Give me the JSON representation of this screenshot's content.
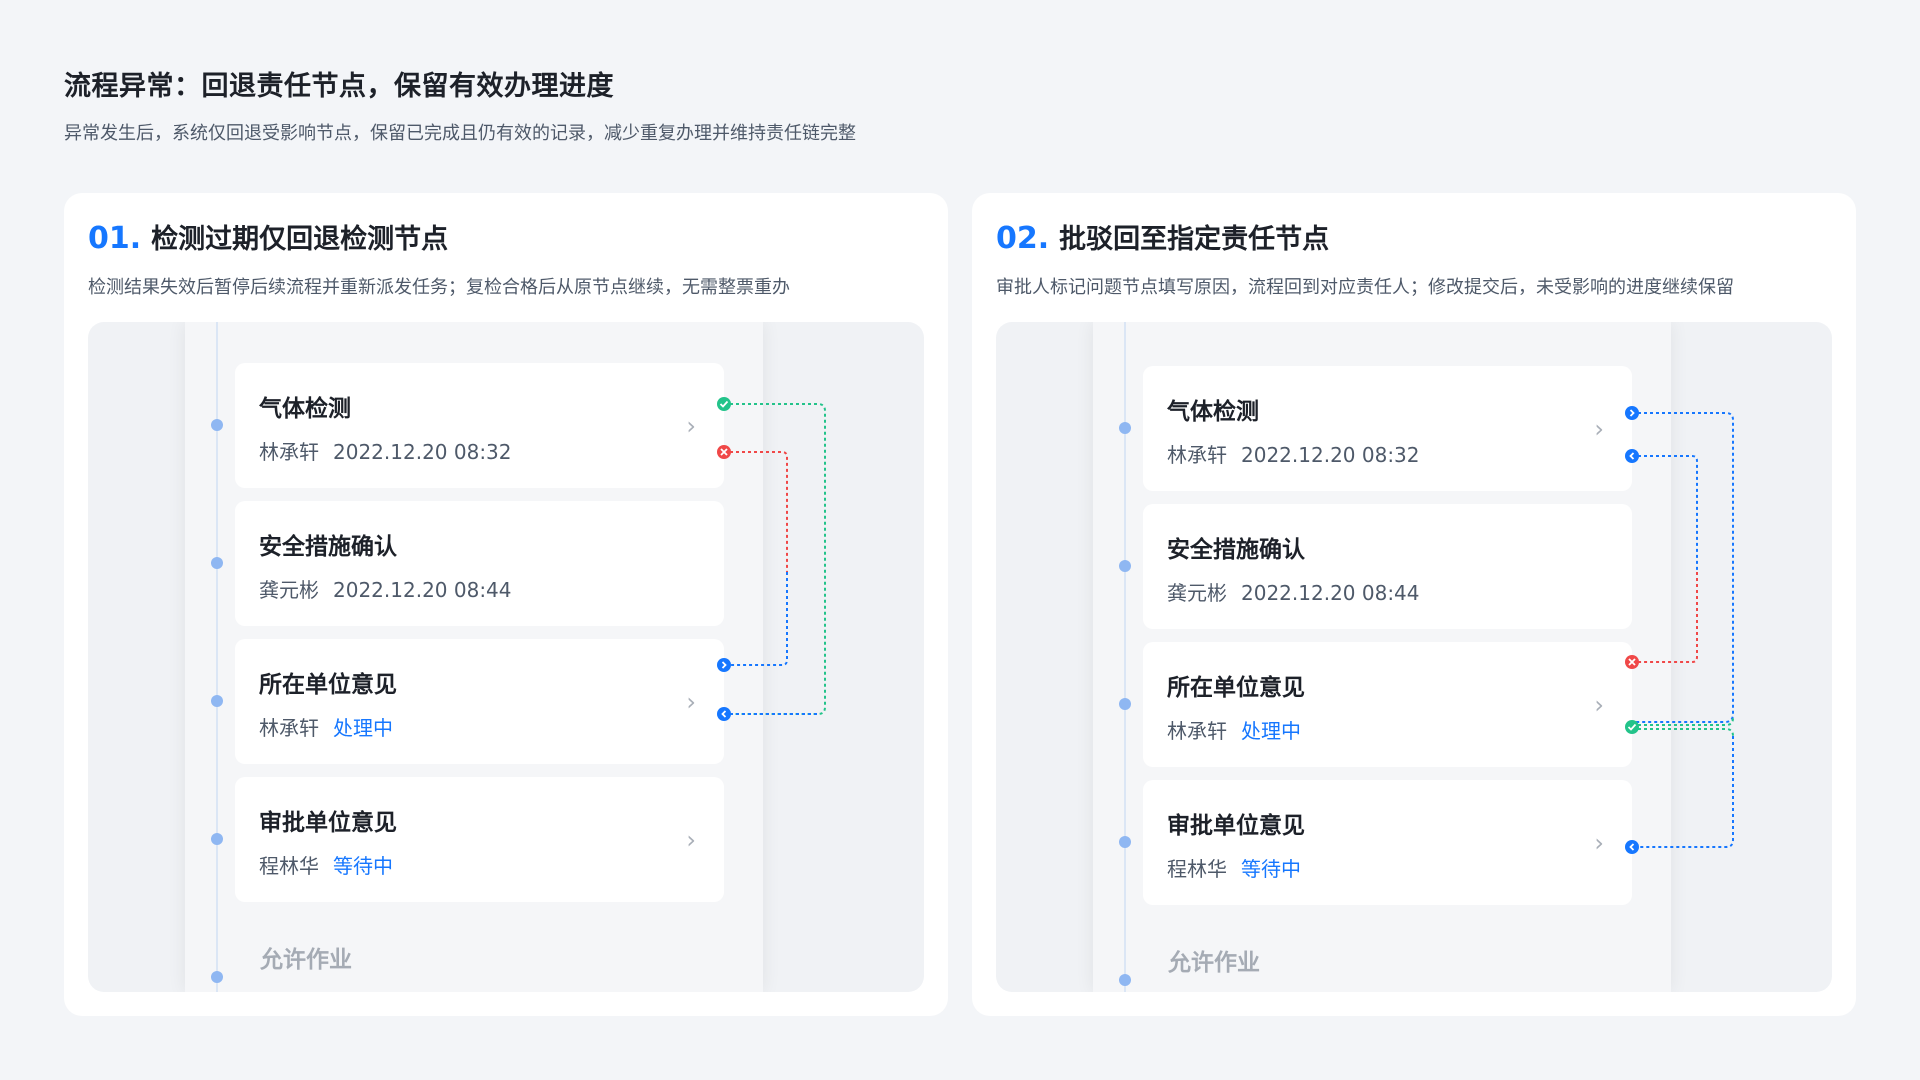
{
  "page": {
    "title": "流程异常：回退责任节点，保留有效办理进度",
    "subtitle": "异常发生后，系统仅回退受影响节点，保留已完成且仍有效的记录，减少重复办理并维持责任链完整"
  },
  "colors": {
    "accent": "#1677ff",
    "success": "#23c38a",
    "error": "#f04848",
    "muted": "#a5abb4"
  },
  "panels": [
    {
      "num": "01.",
      "title": "检测过期仅回退检测节点",
      "desc": "检测结果失效后暂停后续流程并重新派发任务；复检合格后从原节点继续，无需整票重办",
      "nodes": [
        {
          "title": "气体检测",
          "who": "林承轩",
          "when": "2022.12.20 08:32",
          "status": ""
        },
        {
          "title": "安全措施确认",
          "who": "龚元彬",
          "when": "2022.12.20 08:44",
          "status": ""
        },
        {
          "title": "所在单位意见",
          "who": "林承轩",
          "when": "",
          "status": "处理中"
        },
        {
          "title": "审批单位意见",
          "who": "程林华",
          "when": "",
          "status": "等待中"
        }
      ],
      "bottom_label": "允许作业"
    },
    {
      "num": "02.",
      "title": "批驳回至指定责任节点",
      "desc": "审批人标记问题节点填写原因，流程回到对应责任人；修改提交后，未受影响的进度继续保留",
      "nodes": [
        {
          "title": "气体检测",
          "who": "林承轩",
          "when": "2022.12.20 08:32",
          "status": ""
        },
        {
          "title": "安全措施确认",
          "who": "龚元彬",
          "when": "2022.12.20 08:44",
          "status": ""
        },
        {
          "title": "所在单位意见",
          "who": "林承轩",
          "when": "",
          "status": "处理中"
        },
        {
          "title": "审批单位意见",
          "who": "程林华",
          "when": "",
          "status": "等待中"
        }
      ],
      "bottom_label": "允许作业"
    }
  ]
}
